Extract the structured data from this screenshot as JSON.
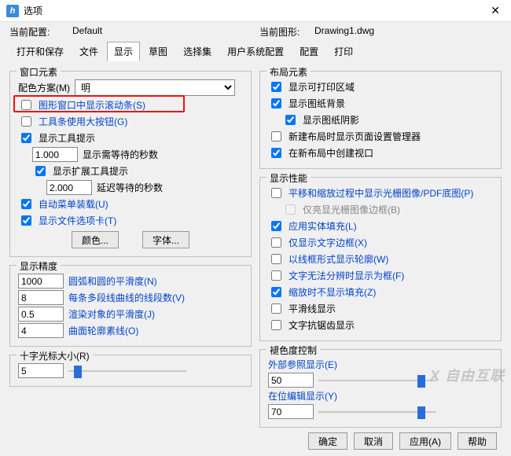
{
  "window": {
    "title": "选项",
    "close_glyph": "✕",
    "app_icon_glyph": "h"
  },
  "info": {
    "config_label": "当前配置:",
    "config_value": "Default",
    "drawing_label": "当前图形:",
    "drawing_value": "Drawing1.dwg"
  },
  "tabs": {
    "items": [
      "打开和保存",
      "文件",
      "显示",
      "草图",
      "选择集",
      "用户系统配置",
      "配置",
      "打印"
    ],
    "active_index": 2
  },
  "left": {
    "window_elements": {
      "legend": "窗口元素",
      "color_scheme_label": "配色方案(M)",
      "color_scheme_value": "明",
      "scrollbar": "图形窗口中显示滚动条(S)",
      "big_buttons": "工具条使用大按钮(G)",
      "tooltips": "显示工具提示",
      "wait_seconds_value": "1.000",
      "wait_seconds_label": "显示需等待的秒数",
      "ext_tooltip": "显示扩展工具提示",
      "delay_value": "2.000",
      "delay_label": "延迟等待的秒数",
      "autoload_menu": "自动菜单装载(U)",
      "file_tabs": "显示文件选项卡(T)",
      "colors_btn": "颜色...",
      "fonts_btn": "字体..."
    },
    "display_precision": {
      "legend": "显示精度",
      "arc_smooth_value": "1000",
      "arc_smooth_label": "圆弧和圆的平滑度(N)",
      "polyline_segs_value": "8",
      "polyline_segs_label": "每条多段线曲线的线段数(V)",
      "render_smooth_value": "0.5",
      "render_smooth_label": "渲染对象的平滑度(J)",
      "surface_lines_value": "4",
      "surface_lines_label": "曲面轮廓素线(O)"
    },
    "cursor": {
      "legend": "十字光标大小(R)",
      "value": "5",
      "slider_pct": 5
    }
  },
  "right": {
    "layout_elements": {
      "legend": "布局元素",
      "show_printable": "显示可打印区域",
      "show_paper_bg": "显示图纸背景",
      "show_paper_shadow": "显示图纸阴影",
      "new_layout_pgsetup": "新建布局时显示页面设置管理器",
      "create_viewport": "在新布局中创建视口"
    },
    "display_perf": {
      "legend": "显示性能",
      "pan_zoom_raster": "平移和缩放过程中显示光栅图像/PDF底图(P)",
      "highlight_raster_border": "仅亮显光栅图像边框(B)",
      "solid_fill": "应用实体填充(L)",
      "text_frame_only": "仅显示文字边框(X)",
      "wireframe_sil": "以线框形式显示轮廓(W)",
      "text_frame_alt": "文字无法分辨时显示为框(F)",
      "no_fill_on_zoom": "缩放时不显示填充(Z)",
      "smooth_line": "平滑线显示",
      "antialias_text": "文字抗锯齿显示"
    },
    "fade": {
      "legend": "褪色度控制",
      "xref_label": "外部参照显示(E)",
      "xref_value": "50",
      "xref_slider_pct": 90,
      "inplace_label": "在位编辑显示(Y)",
      "inplace_value": "70",
      "inplace_slider_pct": 90
    }
  },
  "buttons": {
    "ok": "确定",
    "cancel": "取消",
    "apply": "应用(A)",
    "help": "帮助"
  },
  "watermark": "X 自由互联"
}
